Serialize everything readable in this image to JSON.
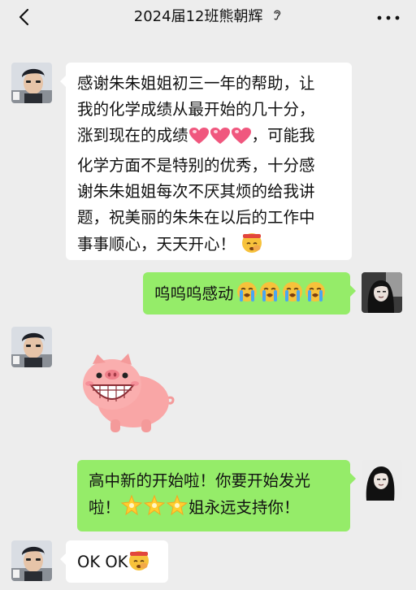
{
  "header": {
    "title": "2024届12班熊朝辉",
    "back_icon": "chevron-left-icon",
    "ear_icon": "ear-icon",
    "more_icon": "more-dots-icon"
  },
  "messages": [
    {
      "from": "contact",
      "lines": [
        "感谢朱朱姐姐初三一年的帮助，让",
        "我的化学成绩从最开始的几十分，",
        "涨到现在的成绩",
        "，可能我",
        "化学方面不是特别的优秀，十分感",
        "谢朱朱姐姐每次不厌其烦的给我讲",
        "题，祝美丽的朱朱在以后的工作中",
        "事事顺心，天天开心！"
      ]
    },
    {
      "from": "me",
      "text": "呜呜呜感动"
    },
    {
      "from": "contact",
      "sticker": "pink-pig-sticker"
    },
    {
      "from": "me",
      "lines": [
        "高中新的开始啦！你要开始发光",
        "啦！",
        "姐永远支持你！"
      ]
    },
    {
      "from": "contact",
      "text": "OK OK"
    }
  ],
  "colors": {
    "background": "#ededed",
    "incoming_bubble": "#ffffff",
    "outgoing_bubble": "#95ec69"
  }
}
